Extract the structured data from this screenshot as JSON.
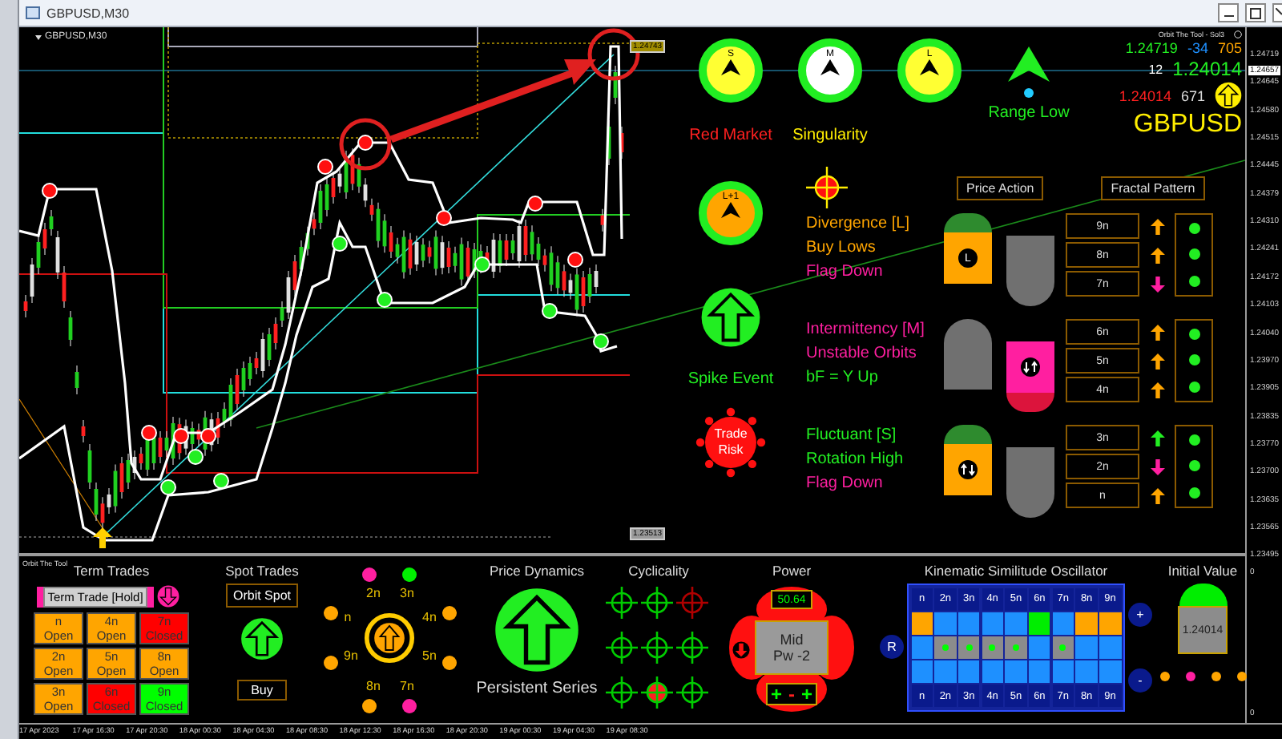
{
  "window": {
    "title": "GBPUSD,M30"
  },
  "chart": {
    "label": "GBPUSD,M30",
    "price_tags": [
      {
        "text": "1.24743",
        "color": "#a08c00"
      },
      {
        "text": "1.23513",
        "color": "#9a9a9a"
      }
    ],
    "current_price": "1.24657",
    "price_axis": [
      "1.24719",
      "1.24645",
      "1.24580",
      "1.24515",
      "1.24445",
      "1.24379",
      "1.24310",
      "1.24241",
      "1.24172",
      "1.24103",
      "1.24040",
      "1.23970",
      "1.23905",
      "1.23835",
      "1.23770",
      "1.23700",
      "1.23635",
      "1.23565",
      "1.23495"
    ],
    "time_axis": [
      "17 Apr 2023",
      "17 Apr 16:30",
      "17 Apr 20:30",
      "18 Apr 00:30",
      "18 Apr 04:30",
      "18 Apr 08:30",
      "18 Apr 12:30",
      "18 Apr 16:30",
      "18 Apr 20:30",
      "19 Apr 00:30",
      "19 Apr 04:30",
      "19 Apr 08:30"
    ]
  },
  "dashboard": {
    "timeframes": [
      {
        "letter": "S",
        "color": "#ffff33"
      },
      {
        "letter": "M",
        "color": "#ffffff"
      },
      {
        "letter": "L",
        "color": "#ffff33"
      }
    ],
    "trend": {
      "up": true,
      "label": "Range Low"
    },
    "info": {
      "tool": "Orbit The Tool - Sol3",
      "ask": "1.24719",
      "change": "-34",
      "count_1": "705",
      "bars": "12",
      "price": "1.24014",
      "low": "1.24014",
      "count_2": "671",
      "symbol": "GBPUSD",
      "up": true
    },
    "market": "Red Market",
    "state": "Singularity",
    "next_level": {
      "letter": "L+1",
      "color": "#ffa500"
    },
    "buttons": [
      "Price Action",
      "Fractal Pattern"
    ],
    "spike": {
      "label": "Spike Event",
      "up": true
    },
    "risk": "Trade Risk",
    "groups": [
      {
        "lines": [
          {
            "text": "Divergence [L]",
            "color": "#ffa500"
          },
          {
            "text": "Buy Lows",
            "color": "#ffa500"
          },
          {
            "text": "Flag Down",
            "color": "#ff1fa0"
          }
        ],
        "marker": {
          "kind": "left",
          "dome": {
            "color": "#2e8b2e"
          },
          "body": {
            "color": "#ffa500"
          },
          "badge": {
            "kind": "letter",
            "text": "L"
          }
        },
        "rows": [
          {
            "label": "9n",
            "up": true,
            "color": "#ffa500"
          },
          {
            "label": "8n",
            "up": true,
            "color": "#ffa500"
          },
          {
            "label": "7n",
            "up": false,
            "color": "#ff1fa0"
          }
        ]
      },
      {
        "lines": [
          {
            "text": "Intermittency [M]",
            "color": "#ff1fa0"
          },
          {
            "text": "Unstable Orbits",
            "color": "#ff1fa0"
          },
          {
            "text": "bF = Y Up",
            "color": "#22ee22"
          }
        ],
        "marker": {
          "kind": "right",
          "dome": {
            "color": "#dc143c"
          },
          "body": {
            "color": "#ff1fa0"
          },
          "badge": {
            "kind": "down-up"
          }
        },
        "rows": [
          {
            "label": "6n",
            "up": true,
            "color": "#ffa500"
          },
          {
            "label": "5n",
            "up": true,
            "color": "#ffa500"
          },
          {
            "label": "4n",
            "up": true,
            "color": "#ffa500"
          }
        ]
      },
      {
        "lines": [
          {
            "text": "Fluctuant [S]",
            "color": "#22ee22"
          },
          {
            "text": "Rotation High",
            "color": "#22ee22"
          },
          {
            "text": "Flag Down",
            "color": "#ff1fa0"
          }
        ],
        "marker": {
          "kind": "left",
          "dome": {
            "color": "#2e8b2e"
          },
          "body": {
            "color": "#ffa500"
          },
          "badge": {
            "kind": "up-down"
          }
        },
        "rows": [
          {
            "label": "3n",
            "up": true,
            "color": "#22ee22"
          },
          {
            "label": "2n",
            "up": false,
            "color": "#ff1fa0"
          },
          {
            "label": "n",
            "up": true,
            "color": "#ffa500"
          }
        ]
      }
    ]
  },
  "panel": {
    "tool": "Orbit The Tool",
    "term": {
      "title": "Term Trades",
      "hold": "Term Trade [Hold]",
      "up": false,
      "cells": [
        {
          "label": "n",
          "status": "Open",
          "color": "#ffa500"
        },
        {
          "label": "4n",
          "status": "Open",
          "color": "#ffa500"
        },
        {
          "label": "7n",
          "status": "Closed",
          "color": "#ff0000"
        },
        {
          "label": "2n",
          "status": "Open",
          "color": "#ffa500"
        },
        {
          "label": "5n",
          "status": "Open",
          "color": "#ffa500"
        },
        {
          "label": "8n",
          "status": "Open",
          "color": "#ffa500"
        },
        {
          "label": "3n",
          "status": "Open",
          "color": "#ffa500"
        },
        {
          "label": "6n",
          "status": "Closed",
          "color": "#ff0000"
        },
        {
          "label": "9n",
          "status": "Closed",
          "color": "#00ff00"
        }
      ]
    },
    "spot": {
      "title": "Spot Trades",
      "button": "Orbit Spot",
      "up": true,
      "action": "Buy"
    },
    "wheel": {
      "up": true,
      "points": [
        {
          "label": "2n",
          "color": "#ff1fa0"
        },
        {
          "label": "3n",
          "color": "#00ee00"
        },
        {
          "label": "4n",
          "color": "#ffa500"
        },
        {
          "label": "5n",
          "color": "#ffa500"
        },
        {
          "label": "7n",
          "color": "#ff1fa0"
        },
        {
          "label": "8n",
          "color": "#ffa500"
        },
        {
          "label": "9n",
          "color": "#ffa500"
        },
        {
          "label": "n",
          "color": "#ffa500"
        }
      ]
    },
    "dynamics": {
      "title": "Price Dynamics",
      "up": true,
      "label": "Persistent Series"
    },
    "cyclicality": {
      "title": "Cyclicality",
      "targets": [
        {
          "color": "#00cc00",
          "hit": false
        },
        {
          "color": "#00cc00",
          "hit": false
        },
        {
          "color": "#b00000",
          "hit": false
        },
        {
          "color": "#00cc00",
          "hit": false
        },
        {
          "color": "#00cc00",
          "hit": false
        },
        {
          "color": "#00cc00",
          "hit": false
        },
        {
          "color": "#00cc00",
          "hit": false
        },
        {
          "color": "#00cc00",
          "hit": true
        },
        {
          "color": "#00cc00",
          "hit": false
        }
      ]
    },
    "power": {
      "title": "Power",
      "reading": "50.64",
      "lines": [
        "Mid",
        "Pw -2"
      ],
      "up": false,
      "signs": [
        {
          "text": "+",
          "color": "#00ff00"
        },
        {
          "text": "-",
          "color": "#ff2020"
        },
        {
          "text": "+",
          "color": "#00ff00"
        }
      ]
    },
    "oscillator": {
      "title": "Kinematic Similitude Oscillator",
      "header": [
        "n",
        "2n",
        "3n",
        "4n",
        "5n",
        "6n",
        "7n",
        "8n",
        "9n"
      ],
      "footer": [
        "n",
        "2n",
        "3n",
        "4n",
        "5n",
        "6n",
        "7n",
        "8n",
        "9n"
      ],
      "rows": [
        [
          {
            "color": "#ffa500",
            "dot": false
          },
          {
            "color": "#1e90ff",
            "dot": false
          },
          {
            "color": "#1e90ff",
            "dot": false
          },
          {
            "color": "#1e90ff",
            "dot": false
          },
          {
            "color": "#1e90ff",
            "dot": false
          },
          {
            "color": "#00ee00",
            "dot": false
          },
          {
            "color": "#1e90ff",
            "dot": false
          },
          {
            "color": "#ffa500",
            "dot": false
          },
          {
            "color": "#ffa500",
            "dot": false
          }
        ],
        [
          {
            "color": "#1e90ff",
            "dot": false
          },
          {
            "color": "#8c8c8c",
            "dot": true
          },
          {
            "color": "#8c8c8c",
            "dot": true
          },
          {
            "color": "#8c8c8c",
            "dot": true
          },
          {
            "color": "#8c8c8c",
            "dot": true
          },
          {
            "color": "#1e90ff",
            "dot": false
          },
          {
            "color": "#8c8c8c",
            "dot": true
          },
          {
            "color": "#1e90ff",
            "dot": false
          },
          {
            "color": "#1e90ff",
            "dot": false
          }
        ],
        [
          {
            "color": "#1e90ff",
            "dot": false
          },
          {
            "color": "#1e90ff",
            "dot": false
          },
          {
            "color": "#1e90ff",
            "dot": false
          },
          {
            "color": "#1e90ff",
            "dot": false
          },
          {
            "color": "#1e90ff",
            "dot": false
          },
          {
            "color": "#1e90ff",
            "dot": false
          },
          {
            "color": "#1e90ff",
            "dot": false
          },
          {
            "color": "#1e90ff",
            "dot": false
          },
          {
            "color": "#1e90ff",
            "dot": false
          }
        ]
      ],
      "reset": "R",
      "plus": "+",
      "minus": "-"
    },
    "initial": {
      "title": "Initial Value",
      "value": "1.24014",
      "dots": [
        {
          "color": "#ffa500"
        },
        {
          "color": "#ff1fa0"
        },
        {
          "color": "#ffa500"
        },
        {
          "color": "#ffa500"
        }
      ]
    },
    "axis": [
      "0",
      "0"
    ]
  }
}
